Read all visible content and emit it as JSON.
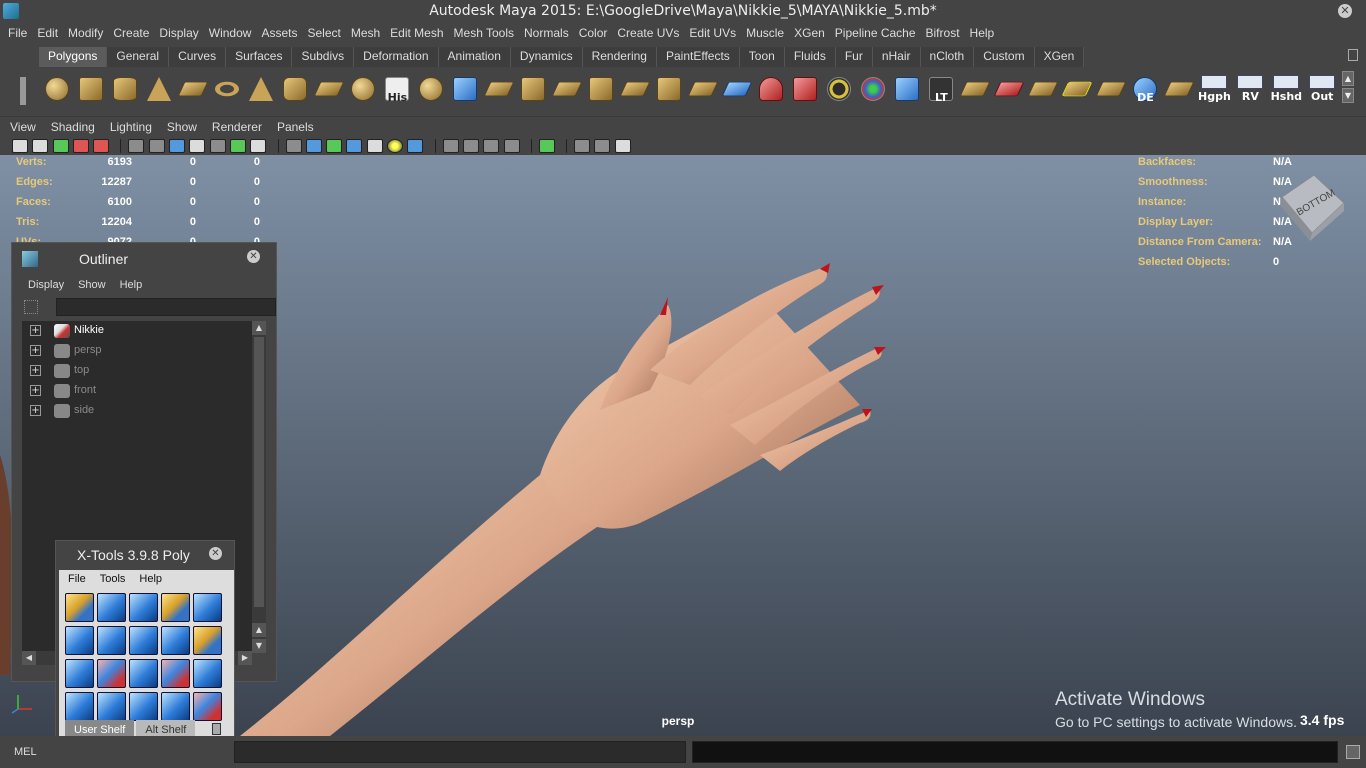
{
  "title": "Autodesk Maya 2015: E:\\GoogleDrive\\Maya\\Nikkie_5\\MAYA\\Nikkie_5.mb*",
  "main_menu": [
    "File",
    "Edit",
    "Modify",
    "Create",
    "Display",
    "Window",
    "Assets",
    "Select",
    "Mesh",
    "Edit Mesh",
    "Mesh Tools",
    "Normals",
    "Color",
    "Create UVs",
    "Edit UVs",
    "Muscle",
    "XGen",
    "Pipeline Cache",
    "Bifrost",
    "Help"
  ],
  "shelf": {
    "tabs": [
      "Polygons",
      "General",
      "Curves",
      "Surfaces",
      "Subdivs",
      "Deformation",
      "Animation",
      "Dynamics",
      "Rendering",
      "PaintEffects",
      "Toon",
      "Fluids",
      "Fur",
      "nHair",
      "nCloth",
      "Custom",
      "XGen"
    ],
    "active_tab": "Polygons",
    "icon_labels": {
      "his": "His",
      "lt": "LT",
      "de": "DE",
      "hgph": "Hgph",
      "rv": "RV",
      "hshd": "Hshd",
      "out": "Out"
    }
  },
  "panel_menu": [
    "View",
    "Shading",
    "Lighting",
    "Show",
    "Renderer",
    "Panels"
  ],
  "hud": {
    "left": [
      {
        "label": "Verts:",
        "v1": "6193",
        "v2": "0",
        "v3": "0"
      },
      {
        "label": "Edges:",
        "v1": "12287",
        "v2": "0",
        "v3": "0"
      },
      {
        "label": "Faces:",
        "v1": "6100",
        "v2": "0",
        "v3": "0"
      },
      {
        "label": "Tris:",
        "v1": "12204",
        "v2": "0",
        "v3": "0"
      },
      {
        "label": "UVs:",
        "v1": "9072",
        "v2": "0",
        "v3": "0"
      }
    ],
    "right": [
      {
        "label": "Backfaces:",
        "value": "N/A"
      },
      {
        "label": "Smoothness:",
        "value": "N/A"
      },
      {
        "label": "Instance:",
        "value": "N/A"
      },
      {
        "label": "Display Layer:",
        "value": "N/A"
      },
      {
        "label": "Distance From Camera:",
        "value": "N/A"
      },
      {
        "label": "Selected Objects:",
        "value": "0"
      }
    ],
    "viewcube_label": "BOTTOM"
  },
  "camera_name": "persp",
  "fps": "3.4 fps",
  "activate_windows": {
    "line1": "Activate Windows",
    "line2": "Go to PC settings to activate Windows."
  },
  "outliner": {
    "title": "Outliner",
    "menu": [
      "Display",
      "Show",
      "Help"
    ],
    "filter_value": "",
    "items": [
      {
        "name": "Nikkie",
        "type": "mesh"
      },
      {
        "name": "persp",
        "type": "camera"
      },
      {
        "name": "top",
        "type": "camera"
      },
      {
        "name": "front",
        "type": "camera"
      },
      {
        "name": "side",
        "type": "camera"
      }
    ]
  },
  "xtools": {
    "title": "X-Tools 3.9.8 Poly",
    "menu": [
      "File",
      "Tools",
      "Help"
    ],
    "shelf_tabs": [
      "User Shelf",
      "Alt Shelf"
    ],
    "active_shelf_tab": "User Shelf"
  },
  "command_line": {
    "label": "MEL",
    "input_value": "",
    "output_value": ""
  }
}
